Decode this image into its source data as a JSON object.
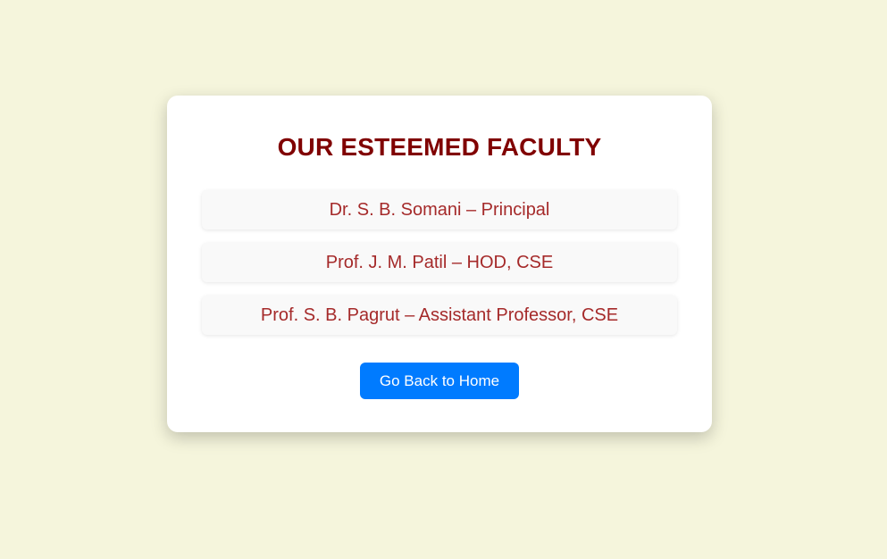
{
  "page": {
    "title": "OUR ESTEEMED FACULTY",
    "faculty": [
      {
        "text": "Dr. S. B. Somani – Principal"
      },
      {
        "text": "Prof. J. M. Patil – HOD, CSE"
      },
      {
        "text": "Prof. S. B. Pagrut – Assistant Professor, CSE"
      }
    ],
    "button_label": "Go Back to Home"
  },
  "colors": {
    "background": "#f5f5dc",
    "title": "#800000",
    "faculty_text": "#a52a2a",
    "button": "#007bff"
  }
}
